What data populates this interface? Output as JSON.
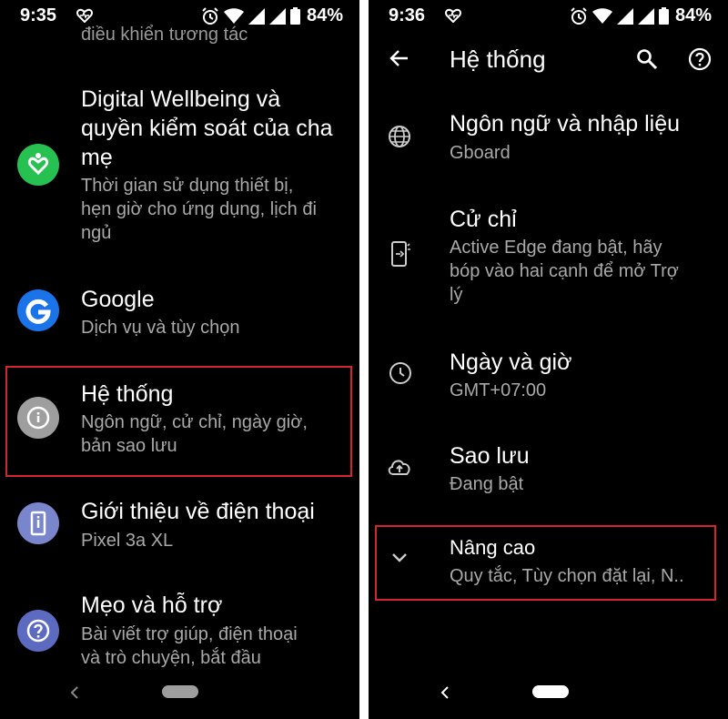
{
  "left": {
    "status": {
      "time": "9:35",
      "battery": "84%"
    },
    "cutoff_text": "điều khiển tương tác",
    "items": [
      {
        "title_lines": [
          "Digital Wellbeing và",
          "quyền kiểm soát của cha",
          "mẹ"
        ],
        "sub_lines": [
          "Thời gian sử dụng thiết bị,",
          "hẹn giờ cho ứng dụng, lịch đi",
          "ngủ"
        ],
        "icon": "digital-wellbeing-icon",
        "color": "#27c152"
      },
      {
        "title_lines": [
          "Google"
        ],
        "sub_lines": [
          "Dịch vụ và tùy chọn"
        ],
        "icon": "google-icon",
        "color": "#1a73e8"
      },
      {
        "title_lines": [
          "Hệ thống"
        ],
        "sub_lines": [
          "Ngôn ngữ, cử chỉ, ngày giờ,",
          "bản sao lưu"
        ],
        "icon": "info-icon",
        "color": "#9e9e9e"
      },
      {
        "title_lines": [
          "Giới thiệu về điện thoại"
        ],
        "sub_lines": [
          "Pixel 3a XL"
        ],
        "icon": "phone-icon",
        "color": "#7986cb"
      },
      {
        "title_lines": [
          "Mẹo và hỗ trợ"
        ],
        "sub_lines": [
          "Bài viết trợ giúp, điện thoại",
          "và trò chuyện, bắt đầu"
        ],
        "icon": "help-icon",
        "color": "#5c6bc0"
      }
    ]
  },
  "right": {
    "status": {
      "time": "9:36",
      "battery": "84%"
    },
    "header": {
      "title": "Hệ thống"
    },
    "items": [
      {
        "title_lines": [
          "Ngôn ngữ và nhập liệu"
        ],
        "sub_lines": [
          "Gboard"
        ],
        "icon": "globe-icon"
      },
      {
        "title_lines": [
          "Cử chỉ"
        ],
        "sub_lines": [
          "Active Edge đang bật, hãy",
          "bóp vào hai cạnh để mở Trợ",
          "lý"
        ],
        "icon": "gesture-phone-icon"
      },
      {
        "title_lines": [
          "Ngày và giờ"
        ],
        "sub_lines": [
          "GMT+07:00"
        ],
        "icon": "clock-icon"
      },
      {
        "title_lines": [
          "Sao lưu"
        ],
        "sub_lines": [
          "Đang bật"
        ],
        "icon": "cloud-upload-icon"
      },
      {
        "title_lines": [
          "Nâng cao"
        ],
        "sub_lines": [
          "Quy tắc, Tùy chọn đặt lại, N.."
        ],
        "icon": "chevron-down-icon"
      }
    ]
  },
  "colors": {
    "highlight": "#d3262c",
    "background": "#000000",
    "secondary_text": "#a9a9a9"
  }
}
